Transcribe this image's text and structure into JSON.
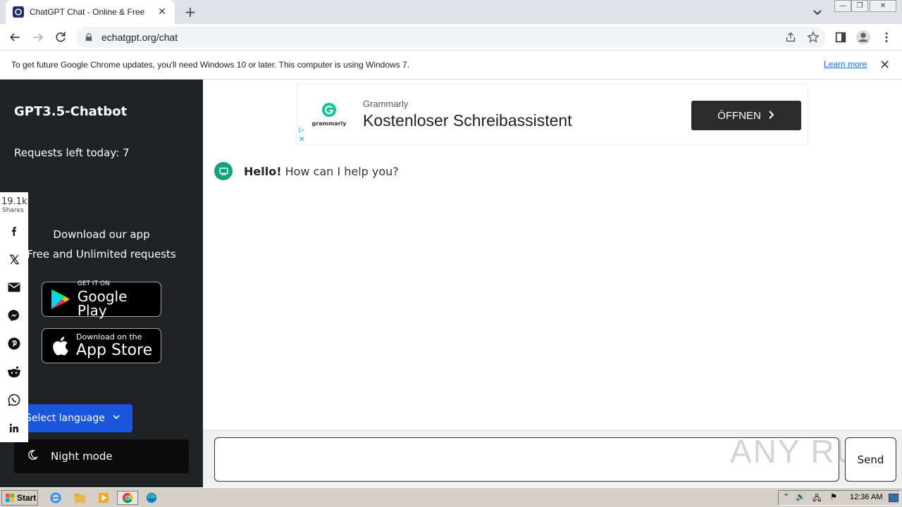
{
  "browser": {
    "tab_title": "ChatGPT Chat - Online & Free",
    "new_tab": "+",
    "url": "echatgpt.org/chat",
    "info_text": "To get future Google Chrome updates, you'll need Windows 10 or later. This computer is using Windows 7.",
    "learn_more": "Learn more"
  },
  "sidebar": {
    "brand": "GPT3.5-Chatbot",
    "requests": "Requests left today: 7",
    "download_title": "Download our app",
    "download_sub": "Free and Unlimited requests",
    "google_play": {
      "small": "GET IT ON",
      "big": "Google Play"
    },
    "app_store": {
      "small": "Download on the",
      "big": "App Store"
    },
    "language_button": "Select language",
    "night_mode": "Night mode"
  },
  "share": {
    "count": "19.1k",
    "label": "Shares",
    "icons": [
      "facebook-icon",
      "x-icon",
      "email-icon",
      "messenger-icon",
      "pinterest-icon",
      "reddit-icon",
      "whatsapp-icon",
      "linkedin-icon"
    ]
  },
  "ad": {
    "logo_text": "grammarly",
    "brand": "Grammarly",
    "headline": "Kostenloser Schreibassistent",
    "cta": "ÖFFNEN"
  },
  "chat": {
    "greeting_bold": "Hello!",
    "greeting_rest": " How can I help you?",
    "send_label": "Send",
    "watermark": "ANY RUN"
  },
  "taskbar": {
    "start_label": "Start",
    "clock": "12:36 AM"
  },
  "colors": {
    "sidebar_bg": "#202123",
    "language_button": "#1a56db",
    "bot_avatar": "#10a37f",
    "link": "#1a73e8"
  }
}
